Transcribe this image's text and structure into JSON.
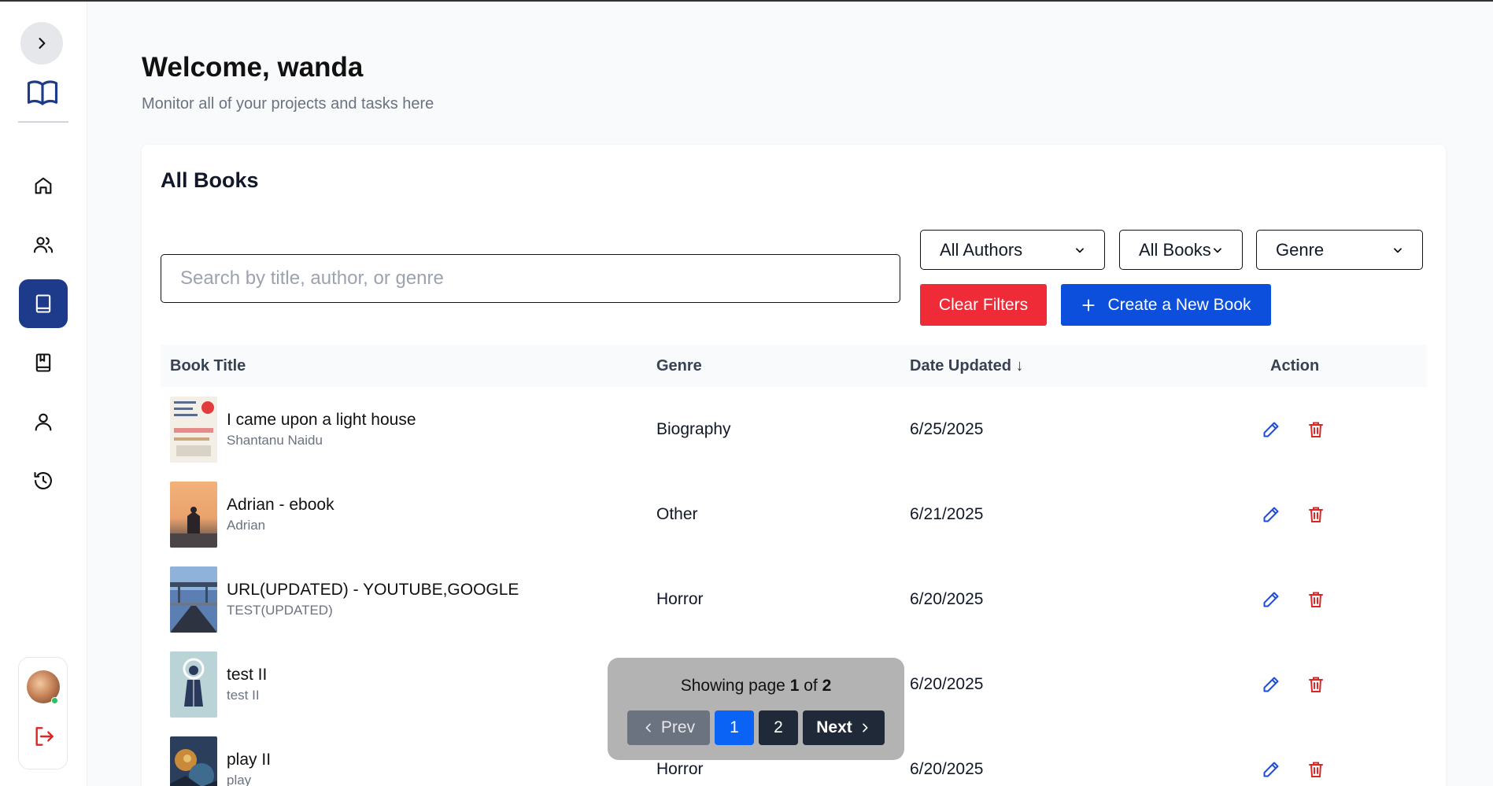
{
  "header": {
    "title": "Welcome, wanda",
    "subtitle": "Monitor all of your projects and tasks here"
  },
  "sidebar": {
    "items": [
      {
        "name": "home",
        "active": false
      },
      {
        "name": "users",
        "active": false
      },
      {
        "name": "books",
        "active": true
      },
      {
        "name": "bookmarks",
        "active": false
      },
      {
        "name": "profile",
        "active": false
      },
      {
        "name": "history",
        "active": false
      }
    ]
  },
  "card": {
    "title": "All Books",
    "search_placeholder": "Search by title, author, or genre",
    "filters": {
      "authors": "All Authors",
      "books": "All Books",
      "genre": "Genre"
    },
    "clear_label": "Clear Filters",
    "create_label": "Create a New Book"
  },
  "table": {
    "columns": {
      "title": "Book Title",
      "genre": "Genre",
      "date": "Date Updated ↓",
      "action": "Action"
    },
    "rows": [
      {
        "title": "I came upon a light house",
        "author": "Shantanu Naidu",
        "genre": "Biography",
        "date": "6/25/2025"
      },
      {
        "title": "Adrian - ebook",
        "author": "Adrian",
        "genre": "Other",
        "date": "6/21/2025"
      },
      {
        "title": "URL(UPDATED) - YOUTUBE,GOOGLE",
        "author": "TEST(UPDATED)",
        "genre": "Horror",
        "date": "6/20/2025"
      },
      {
        "title": "test II",
        "author": "test II",
        "genre": "",
        "date": "6/20/2025"
      },
      {
        "title": "play II",
        "author": "play",
        "genre": "Horror",
        "date": "6/20/2025"
      }
    ]
  },
  "pagination": {
    "showing": "Showing page",
    "current": "1",
    "of": "of",
    "total": "2",
    "prev": "Prev",
    "next": "Next",
    "pages": [
      "1",
      "2"
    ]
  },
  "colors": {
    "accent": "#0b4fdc",
    "danger": "#ef2b38",
    "nav_active": "#1e3a8a"
  }
}
